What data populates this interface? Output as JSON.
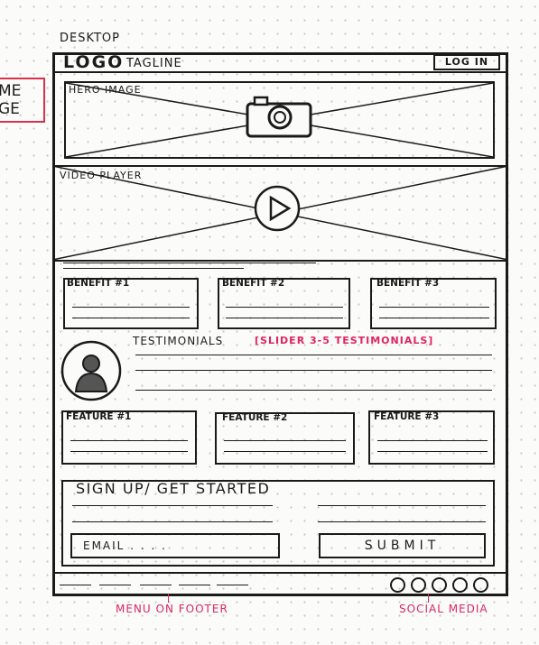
{
  "side_note": {
    "line1": "ME",
    "line2": "GE"
  },
  "desktop_label": "DESKTOP",
  "header": {
    "logo": "LOGO",
    "tagline": "TAGLINE",
    "login": "LOG IN"
  },
  "hero": {
    "label": "HERO IMAGE",
    "icon": "camera-icon"
  },
  "video": {
    "label": "VIDEO PLAYER",
    "icon": "play-icon"
  },
  "benefits": [
    "BENEFIT #1",
    "BENEFIT #2",
    "BENEFIT #3"
  ],
  "testimonials": {
    "label": "TESTIMONIALS",
    "note": "[SLIDER 3-5 TESTIMONIALS]",
    "icon": "avatar-icon"
  },
  "features": [
    "FEATURE #1",
    "FEATURE #2",
    "FEATURE #3"
  ],
  "signup": {
    "title": "SIGN UP/ GET STARTED",
    "email_placeholder": "EMAIL . . . .",
    "submit": "SUBMIT"
  },
  "footer": {
    "social_icon_count": 5,
    "menu_annotation": "MENU ON FOOTER",
    "social_annotation": "SOCIAL MEDIA"
  },
  "colors": {
    "ink": "#1a1a1a",
    "annotation": "#e0245e"
  }
}
